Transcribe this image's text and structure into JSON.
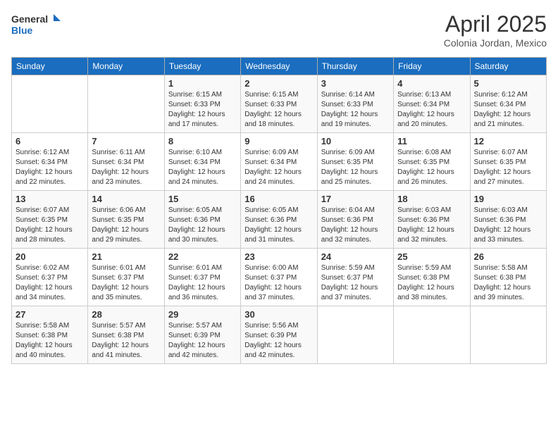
{
  "header": {
    "logo_line1": "General",
    "logo_line2": "Blue",
    "month": "April 2025",
    "location": "Colonia Jordan, Mexico"
  },
  "days_header": [
    "Sunday",
    "Monday",
    "Tuesday",
    "Wednesday",
    "Thursday",
    "Friday",
    "Saturday"
  ],
  "weeks": [
    [
      {
        "day": "",
        "info": ""
      },
      {
        "day": "",
        "info": ""
      },
      {
        "day": "1",
        "info": "Sunrise: 6:15 AM\nSunset: 6:33 PM\nDaylight: 12 hours\nand 17 minutes."
      },
      {
        "day": "2",
        "info": "Sunrise: 6:15 AM\nSunset: 6:33 PM\nDaylight: 12 hours\nand 18 minutes."
      },
      {
        "day": "3",
        "info": "Sunrise: 6:14 AM\nSunset: 6:33 PM\nDaylight: 12 hours\nand 19 minutes."
      },
      {
        "day": "4",
        "info": "Sunrise: 6:13 AM\nSunset: 6:34 PM\nDaylight: 12 hours\nand 20 minutes."
      },
      {
        "day": "5",
        "info": "Sunrise: 6:12 AM\nSunset: 6:34 PM\nDaylight: 12 hours\nand 21 minutes."
      }
    ],
    [
      {
        "day": "6",
        "info": "Sunrise: 6:12 AM\nSunset: 6:34 PM\nDaylight: 12 hours\nand 22 minutes."
      },
      {
        "day": "7",
        "info": "Sunrise: 6:11 AM\nSunset: 6:34 PM\nDaylight: 12 hours\nand 23 minutes."
      },
      {
        "day": "8",
        "info": "Sunrise: 6:10 AM\nSunset: 6:34 PM\nDaylight: 12 hours\nand 24 minutes."
      },
      {
        "day": "9",
        "info": "Sunrise: 6:09 AM\nSunset: 6:34 PM\nDaylight: 12 hours\nand 24 minutes."
      },
      {
        "day": "10",
        "info": "Sunrise: 6:09 AM\nSunset: 6:35 PM\nDaylight: 12 hours\nand 25 minutes."
      },
      {
        "day": "11",
        "info": "Sunrise: 6:08 AM\nSunset: 6:35 PM\nDaylight: 12 hours\nand 26 minutes."
      },
      {
        "day": "12",
        "info": "Sunrise: 6:07 AM\nSunset: 6:35 PM\nDaylight: 12 hours\nand 27 minutes."
      }
    ],
    [
      {
        "day": "13",
        "info": "Sunrise: 6:07 AM\nSunset: 6:35 PM\nDaylight: 12 hours\nand 28 minutes."
      },
      {
        "day": "14",
        "info": "Sunrise: 6:06 AM\nSunset: 6:35 PM\nDaylight: 12 hours\nand 29 minutes."
      },
      {
        "day": "15",
        "info": "Sunrise: 6:05 AM\nSunset: 6:36 PM\nDaylight: 12 hours\nand 30 minutes."
      },
      {
        "day": "16",
        "info": "Sunrise: 6:05 AM\nSunset: 6:36 PM\nDaylight: 12 hours\nand 31 minutes."
      },
      {
        "day": "17",
        "info": "Sunrise: 6:04 AM\nSunset: 6:36 PM\nDaylight: 12 hours\nand 32 minutes."
      },
      {
        "day": "18",
        "info": "Sunrise: 6:03 AM\nSunset: 6:36 PM\nDaylight: 12 hours\nand 32 minutes."
      },
      {
        "day": "19",
        "info": "Sunrise: 6:03 AM\nSunset: 6:36 PM\nDaylight: 12 hours\nand 33 minutes."
      }
    ],
    [
      {
        "day": "20",
        "info": "Sunrise: 6:02 AM\nSunset: 6:37 PM\nDaylight: 12 hours\nand 34 minutes."
      },
      {
        "day": "21",
        "info": "Sunrise: 6:01 AM\nSunset: 6:37 PM\nDaylight: 12 hours\nand 35 minutes."
      },
      {
        "day": "22",
        "info": "Sunrise: 6:01 AM\nSunset: 6:37 PM\nDaylight: 12 hours\nand 36 minutes."
      },
      {
        "day": "23",
        "info": "Sunrise: 6:00 AM\nSunset: 6:37 PM\nDaylight: 12 hours\nand 37 minutes."
      },
      {
        "day": "24",
        "info": "Sunrise: 5:59 AM\nSunset: 6:37 PM\nDaylight: 12 hours\nand 37 minutes."
      },
      {
        "day": "25",
        "info": "Sunrise: 5:59 AM\nSunset: 6:38 PM\nDaylight: 12 hours\nand 38 minutes."
      },
      {
        "day": "26",
        "info": "Sunrise: 5:58 AM\nSunset: 6:38 PM\nDaylight: 12 hours\nand 39 minutes."
      }
    ],
    [
      {
        "day": "27",
        "info": "Sunrise: 5:58 AM\nSunset: 6:38 PM\nDaylight: 12 hours\nand 40 minutes."
      },
      {
        "day": "28",
        "info": "Sunrise: 5:57 AM\nSunset: 6:38 PM\nDaylight: 12 hours\nand 41 minutes."
      },
      {
        "day": "29",
        "info": "Sunrise: 5:57 AM\nSunset: 6:39 PM\nDaylight: 12 hours\nand 42 minutes."
      },
      {
        "day": "30",
        "info": "Sunrise: 5:56 AM\nSunset: 6:39 PM\nDaylight: 12 hours\nand 42 minutes."
      },
      {
        "day": "",
        "info": ""
      },
      {
        "day": "",
        "info": ""
      },
      {
        "day": "",
        "info": ""
      }
    ]
  ]
}
